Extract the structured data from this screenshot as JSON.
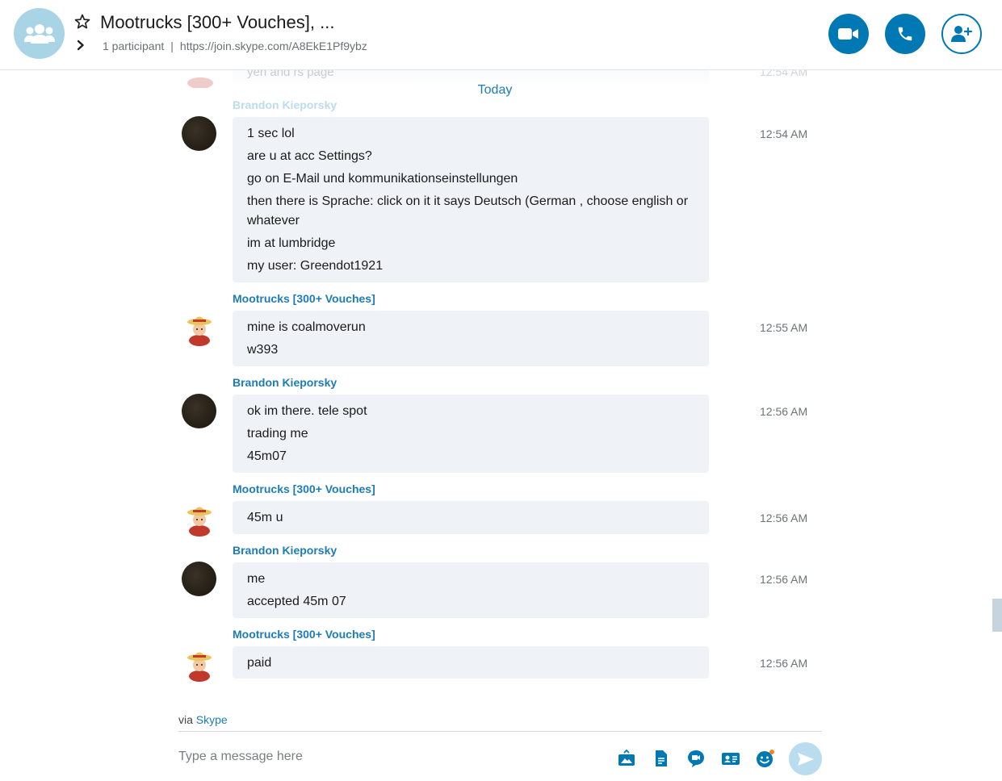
{
  "header": {
    "title": "Mootrucks [300+ Vouches], ...",
    "participants": "1 participant",
    "separator": "|",
    "join_link": "https://join.skype.com/A8EkE1Pf9ybz",
    "buttons": [
      "video-call",
      "audio-call",
      "add-people"
    ]
  },
  "conversation": {
    "ghost_text": "yeh and rs page",
    "ghost_time": "12:54 AM",
    "day_label": "Today",
    "groups": [
      {
        "sender": "Brandon Kieporsky",
        "time": "12:54 AM",
        "lines": [
          "1 sec lol",
          "are u at acc Settings?",
          "go on E-Mail und kommunikationseinstellungen",
          "then there is Sprache: click on it it says Deutsch (German , choose english or whatever",
          "im at lumbridge",
          "my user: Greendot1921"
        ]
      },
      {
        "sender": "Mootrucks [300+ Vouches]",
        "time": "12:55 AM",
        "lines": [
          "mine is coalmoverun",
          "w393"
        ]
      },
      {
        "sender": "Brandon Kieporsky",
        "time": "12:56 AM",
        "lines": [
          "ok im there. tele spot",
          "trading me",
          "45m07"
        ]
      },
      {
        "sender": "Mootrucks [300+ Vouches]",
        "time": "12:56 AM",
        "lines": [
          "45m u"
        ]
      },
      {
        "sender": "Brandon Kieporsky",
        "time": "12:56 AM",
        "lines": [
          "me",
          "accepted 45m 07"
        ]
      },
      {
        "sender": "Mootrucks [300+ Vouches]",
        "time": "12:56 AM",
        "lines": [
          "paid"
        ]
      }
    ]
  },
  "composer": {
    "via_prefix": "via",
    "via_link": "Skype",
    "placeholder": "Type a message here",
    "tools": [
      "media-icon",
      "file-icon",
      "video-message-icon",
      "contact-card-icon",
      "emoji-icon"
    ],
    "send": "send-icon"
  },
  "colors": {
    "accent": "#0078b4",
    "sender": "#1d7cb5",
    "bubble": "#eff2f6"
  }
}
